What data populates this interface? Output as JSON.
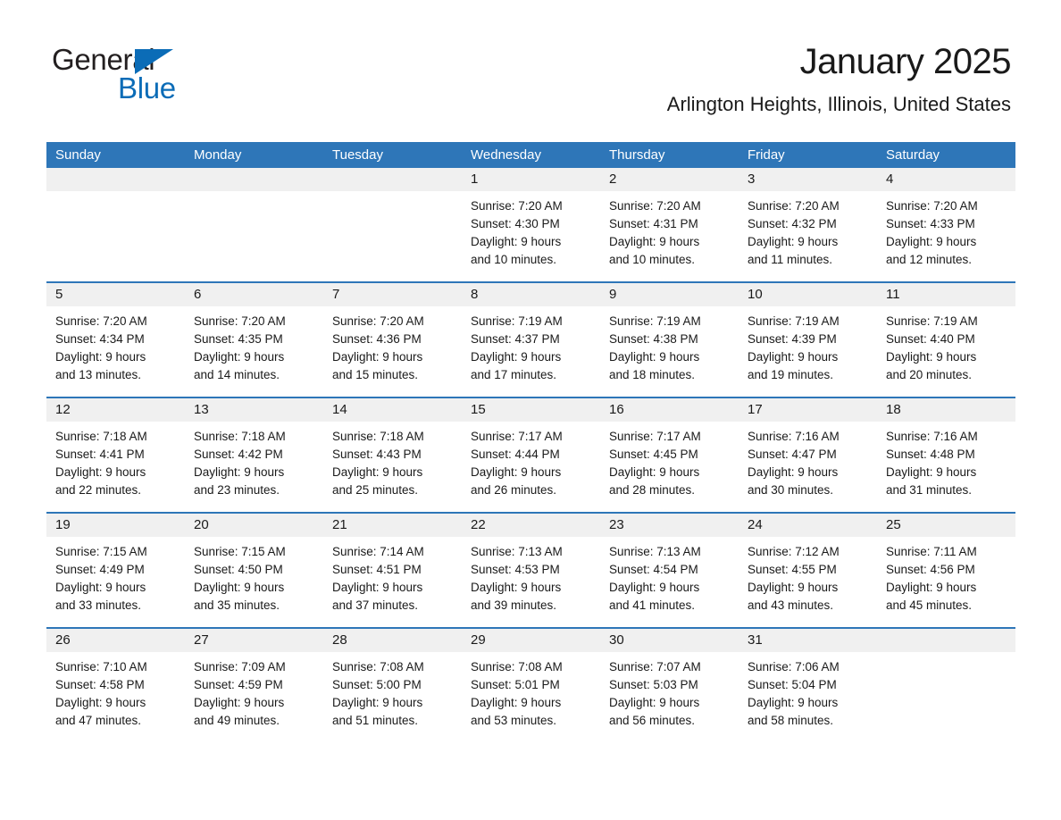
{
  "brand": {
    "name_part1": "General",
    "name_part2": "Blue",
    "accent_color": "#0b6cb7"
  },
  "header": {
    "title": "January 2025",
    "subtitle": "Arlington Heights, Illinois, United States",
    "header_bg_color": "#2e76b8",
    "daynum_bg_color": "#f0f0f0"
  },
  "weekdays": [
    "Sunday",
    "Monday",
    "Tuesday",
    "Wednesday",
    "Thursday",
    "Friday",
    "Saturday"
  ],
  "weeks": [
    [
      {
        "day": "",
        "lines": []
      },
      {
        "day": "",
        "lines": []
      },
      {
        "day": "",
        "lines": []
      },
      {
        "day": "1",
        "lines": [
          "Sunrise: 7:20 AM",
          "Sunset: 4:30 PM",
          "Daylight: 9 hours",
          "and 10 minutes."
        ]
      },
      {
        "day": "2",
        "lines": [
          "Sunrise: 7:20 AM",
          "Sunset: 4:31 PM",
          "Daylight: 9 hours",
          "and 10 minutes."
        ]
      },
      {
        "day": "3",
        "lines": [
          "Sunrise: 7:20 AM",
          "Sunset: 4:32 PM",
          "Daylight: 9 hours",
          "and 11 minutes."
        ]
      },
      {
        "day": "4",
        "lines": [
          "Sunrise: 7:20 AM",
          "Sunset: 4:33 PM",
          "Daylight: 9 hours",
          "and 12 minutes."
        ]
      }
    ],
    [
      {
        "day": "5",
        "lines": [
          "Sunrise: 7:20 AM",
          "Sunset: 4:34 PM",
          "Daylight: 9 hours",
          "and 13 minutes."
        ]
      },
      {
        "day": "6",
        "lines": [
          "Sunrise: 7:20 AM",
          "Sunset: 4:35 PM",
          "Daylight: 9 hours",
          "and 14 minutes."
        ]
      },
      {
        "day": "7",
        "lines": [
          "Sunrise: 7:20 AM",
          "Sunset: 4:36 PM",
          "Daylight: 9 hours",
          "and 15 minutes."
        ]
      },
      {
        "day": "8",
        "lines": [
          "Sunrise: 7:19 AM",
          "Sunset: 4:37 PM",
          "Daylight: 9 hours",
          "and 17 minutes."
        ]
      },
      {
        "day": "9",
        "lines": [
          "Sunrise: 7:19 AM",
          "Sunset: 4:38 PM",
          "Daylight: 9 hours",
          "and 18 minutes."
        ]
      },
      {
        "day": "10",
        "lines": [
          "Sunrise: 7:19 AM",
          "Sunset: 4:39 PM",
          "Daylight: 9 hours",
          "and 19 minutes."
        ]
      },
      {
        "day": "11",
        "lines": [
          "Sunrise: 7:19 AM",
          "Sunset: 4:40 PM",
          "Daylight: 9 hours",
          "and 20 minutes."
        ]
      }
    ],
    [
      {
        "day": "12",
        "lines": [
          "Sunrise: 7:18 AM",
          "Sunset: 4:41 PM",
          "Daylight: 9 hours",
          "and 22 minutes."
        ]
      },
      {
        "day": "13",
        "lines": [
          "Sunrise: 7:18 AM",
          "Sunset: 4:42 PM",
          "Daylight: 9 hours",
          "and 23 minutes."
        ]
      },
      {
        "day": "14",
        "lines": [
          "Sunrise: 7:18 AM",
          "Sunset: 4:43 PM",
          "Daylight: 9 hours",
          "and 25 minutes."
        ]
      },
      {
        "day": "15",
        "lines": [
          "Sunrise: 7:17 AM",
          "Sunset: 4:44 PM",
          "Daylight: 9 hours",
          "and 26 minutes."
        ]
      },
      {
        "day": "16",
        "lines": [
          "Sunrise: 7:17 AM",
          "Sunset: 4:45 PM",
          "Daylight: 9 hours",
          "and 28 minutes."
        ]
      },
      {
        "day": "17",
        "lines": [
          "Sunrise: 7:16 AM",
          "Sunset: 4:47 PM",
          "Daylight: 9 hours",
          "and 30 minutes."
        ]
      },
      {
        "day": "18",
        "lines": [
          "Sunrise: 7:16 AM",
          "Sunset: 4:48 PM",
          "Daylight: 9 hours",
          "and 31 minutes."
        ]
      }
    ],
    [
      {
        "day": "19",
        "lines": [
          "Sunrise: 7:15 AM",
          "Sunset: 4:49 PM",
          "Daylight: 9 hours",
          "and 33 minutes."
        ]
      },
      {
        "day": "20",
        "lines": [
          "Sunrise: 7:15 AM",
          "Sunset: 4:50 PM",
          "Daylight: 9 hours",
          "and 35 minutes."
        ]
      },
      {
        "day": "21",
        "lines": [
          "Sunrise: 7:14 AM",
          "Sunset: 4:51 PM",
          "Daylight: 9 hours",
          "and 37 minutes."
        ]
      },
      {
        "day": "22",
        "lines": [
          "Sunrise: 7:13 AM",
          "Sunset: 4:53 PM",
          "Daylight: 9 hours",
          "and 39 minutes."
        ]
      },
      {
        "day": "23",
        "lines": [
          "Sunrise: 7:13 AM",
          "Sunset: 4:54 PM",
          "Daylight: 9 hours",
          "and 41 minutes."
        ]
      },
      {
        "day": "24",
        "lines": [
          "Sunrise: 7:12 AM",
          "Sunset: 4:55 PM",
          "Daylight: 9 hours",
          "and 43 minutes."
        ]
      },
      {
        "day": "25",
        "lines": [
          "Sunrise: 7:11 AM",
          "Sunset: 4:56 PM",
          "Daylight: 9 hours",
          "and 45 minutes."
        ]
      }
    ],
    [
      {
        "day": "26",
        "lines": [
          "Sunrise: 7:10 AM",
          "Sunset: 4:58 PM",
          "Daylight: 9 hours",
          "and 47 minutes."
        ]
      },
      {
        "day": "27",
        "lines": [
          "Sunrise: 7:09 AM",
          "Sunset: 4:59 PM",
          "Daylight: 9 hours",
          "and 49 minutes."
        ]
      },
      {
        "day": "28",
        "lines": [
          "Sunrise: 7:08 AM",
          "Sunset: 5:00 PM",
          "Daylight: 9 hours",
          "and 51 minutes."
        ]
      },
      {
        "day": "29",
        "lines": [
          "Sunrise: 7:08 AM",
          "Sunset: 5:01 PM",
          "Daylight: 9 hours",
          "and 53 minutes."
        ]
      },
      {
        "day": "30",
        "lines": [
          "Sunrise: 7:07 AM",
          "Sunset: 5:03 PM",
          "Daylight: 9 hours",
          "and 56 minutes."
        ]
      },
      {
        "day": "31",
        "lines": [
          "Sunrise: 7:06 AM",
          "Sunset: 5:04 PM",
          "Daylight: 9 hours",
          "and 58 minutes."
        ]
      },
      {
        "day": "",
        "lines": []
      }
    ]
  ]
}
